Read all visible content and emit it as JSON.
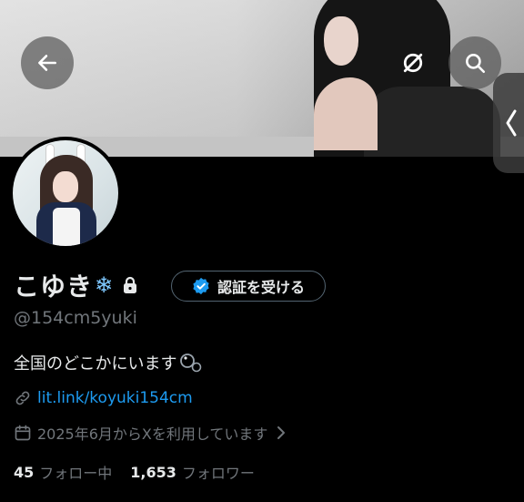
{
  "profile": {
    "display_name": "こゆき",
    "name_emoji": "❄",
    "handle": "@154cm5yuki",
    "bio": "全国のどこかにいます",
    "link": "lit.link/koyuki154cm",
    "joined": "2025年6月からXを利用しています",
    "following_count": "45",
    "following_label": "フォロー中",
    "followers_count": "1,653",
    "followers_label": "フォロワー"
  },
  "buttons": {
    "verify_label": "認証を受ける"
  },
  "icons": {
    "back": "arrow-left-icon",
    "no_link": "link-off-icon",
    "search": "search-icon",
    "side_tab": "chevron-left-icon",
    "lock": "lock-icon",
    "verified": "verified-badge-icon",
    "link": "link-icon",
    "calendar": "calendar-icon",
    "chevron": "chevron-right-icon"
  },
  "colors": {
    "background": "#000000",
    "accent": "#1d9bf0",
    "muted": "#71767b",
    "text": "#e7e9ea"
  }
}
